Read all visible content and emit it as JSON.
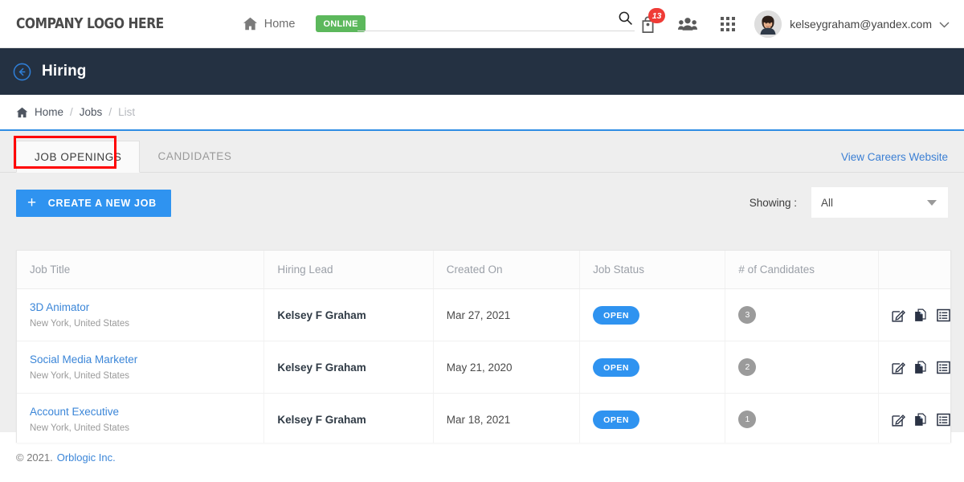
{
  "header": {
    "logo": "COMPANY LOGO HERE",
    "home_label": "Home",
    "home_icon": "home-icon",
    "online_badge": "ONLINE",
    "search_value": "",
    "search_placeholder": "",
    "search_icon": "search-icon",
    "bag_icon": "bag-icon",
    "notification_count": "13",
    "people_icon": "people-group-icon",
    "apps_icon": "apps-grid-icon",
    "avatar_icon": "user-avatar",
    "user_email": "kelseygraham@yandex.com",
    "caret_icon": "chevron-down-icon"
  },
  "titlebar": {
    "back_icon": "back-arrow-circle-icon",
    "title": "Hiring"
  },
  "breadcrumb": {
    "home_icon": "home-icon",
    "items": [
      "Home",
      "Jobs",
      "List"
    ],
    "separator": "/"
  },
  "tabs": [
    {
      "label": "JOB OPENINGS",
      "active": true
    },
    {
      "label": "CANDIDATES",
      "active": false
    }
  ],
  "careers_link": "View Careers Website",
  "toolbar": {
    "create_label": "CREATE A NEW JOB",
    "plus_icon": "plus-icon",
    "showing_label": "Showing :",
    "filter_value": "All",
    "filter_options": [
      "All"
    ]
  },
  "table": {
    "columns": [
      "Job Title",
      "Hiring Lead",
      "Created On",
      "Job Status",
      "# of Candidates",
      ""
    ],
    "rows": [
      {
        "title": "3D Animator",
        "location": "New York, United States",
        "lead": "Kelsey F Graham",
        "created": "Mar 27, 2021",
        "status": "OPEN",
        "candidates": "3",
        "actions": [
          "edit-icon",
          "duplicate-icon",
          "details-list-icon"
        ]
      },
      {
        "title": "Social Media Marketer",
        "location": "New York, United States",
        "lead": "Kelsey F Graham",
        "created": "May 21, 2020",
        "status": "OPEN",
        "candidates": "2",
        "actions": [
          "edit-icon",
          "duplicate-icon",
          "details-list-icon"
        ]
      },
      {
        "title": "Account Executive",
        "location": "New York, United States",
        "lead": "Kelsey F Graham",
        "created": "Mar 18, 2021",
        "status": "OPEN",
        "candidates": "1",
        "actions": [
          "edit-icon",
          "duplicate-icon",
          "details-list-icon"
        ]
      }
    ]
  },
  "footer": {
    "copyright": "© 2021.",
    "company": "Orblogic Inc."
  },
  "colors": {
    "accent_blue": "#2f93f0",
    "link_blue": "#3b86d8",
    "dark_navy": "#243142",
    "online_green": "#5cb85c",
    "notif_red": "#ef3b36",
    "highlight_red": "#ff0000",
    "page_gray": "#eeeeee"
  }
}
